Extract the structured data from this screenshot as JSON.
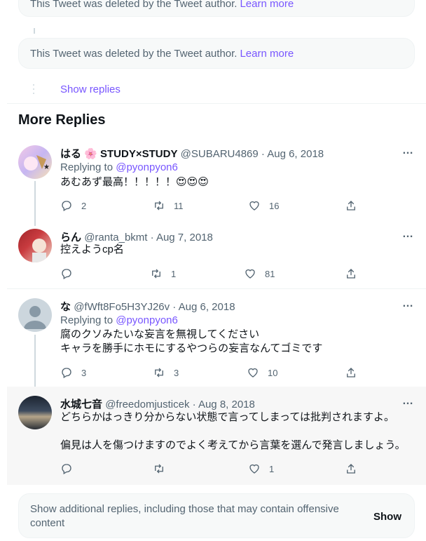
{
  "deleted_notice": {
    "text": "This Tweet was deleted by the Tweet author.",
    "link": "Learn more"
  },
  "show_replies": "Show replies",
  "section_title": "More Replies",
  "tweets": [
    {
      "name": "はる 🌸 STUDY×STUDY",
      "handle_date": "@SUBARU4869 · Aug 6, 2018",
      "replying_prefix": "Replying to",
      "replying_to": "@pyonpyon6",
      "text": "あむあず最高！！！！！😍😍😍",
      "reply_count": "2",
      "retweet_count": "11",
      "like_count": "16"
    },
    {
      "name": "らん",
      "handle_date": "@ranta_bkmt · Aug 7, 2018",
      "text": "控えようcp名",
      "reply_count": "",
      "retweet_count": "1",
      "like_count": "81"
    },
    {
      "name": "な",
      "handle_date": "@fWft8Fo5H3YJ26v · Aug 6, 2018",
      "replying_prefix": "Replying to",
      "replying_to": "@pyonpyon6",
      "text": "腐のクソみたいな妄言を無視してください\nキャラを勝手にホモにするやつらの妄言なんてゴミです",
      "reply_count": "3",
      "retweet_count": "3",
      "like_count": "10"
    },
    {
      "name": "水城七音",
      "handle_date": "@freedomjusticek · Aug 8, 2018",
      "text": "どちらかはっきり分からない状態で言ってしまっては批判されますよ。\n\n偏見は人を傷つけますのでよく考えてから言葉を選んで発言しましょう。",
      "reply_count": "",
      "retweet_count": "",
      "like_count": "1"
    }
  ],
  "more_icon": "…",
  "show_additional": {
    "text": "Show additional replies, including those that may contain offensive content",
    "button": "Show"
  },
  "colors": {
    "accent": "#7856ff",
    "muted": "#536471",
    "panel": "#f7f9f9"
  }
}
